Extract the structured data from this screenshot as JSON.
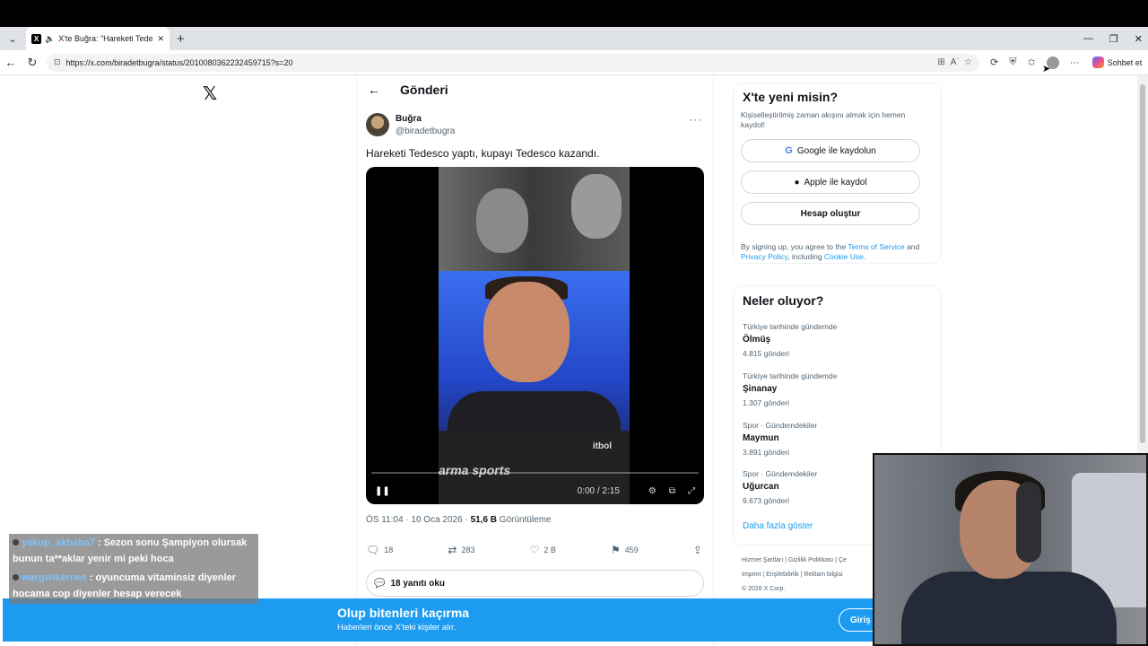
{
  "browser": {
    "tab_title": "X'te Buğra: \"Hareketi Tedesco",
    "url": "https://x.com/biradetbugra/status/2010080362232459715?s=20",
    "copilot_label": "Sohbet et"
  },
  "post": {
    "header_title": "Gönderi",
    "author_name": "Buğra",
    "author_handle": "@biradetbugra",
    "text": "Hareketi Tedesco yaptı, kupayı Tedesco kazandı.",
    "video": {
      "watermark": "arma sports",
      "logo": "itbol",
      "time": "0:00 / 2:15"
    },
    "timestamp": "ÖS 11:04 · 10 Oca 2026 · ",
    "views_count": "51,6 B",
    "views_label": " Görüntüleme",
    "stats": {
      "replies": "18",
      "reposts": "283",
      "likes": "2 B",
      "bookmarks": "459"
    },
    "read_replies": "18 yanıtı oku"
  },
  "signup": {
    "title": "X'te yeni misin?",
    "subtitle": "Kişiselleştirilmiş zaman akışını almak için hemen kaydol!",
    "google_btn": "Google ile kaydolun",
    "apple_btn": "Apple ile kaydol",
    "create_btn": "Hesap oluştur",
    "legal_pre": "By signing up, you agree to the ",
    "terms": "Terms of Service",
    "and": " and ",
    "privacy": "Privacy Policy",
    "including": ", including ",
    "cookie": "Cookie Use",
    "end": "."
  },
  "trends": {
    "title": "Neler oluyor?",
    "items": [
      {
        "context": "Türkiye tarihinde gündemde",
        "name": "Ölmüş",
        "posts": "4.815 gönderi"
      },
      {
        "context": "Türkiye tarihinde gündemde",
        "name": "Şinanay",
        "posts": "1.307 gönderi"
      },
      {
        "context": "Spor · Gündemdekiler",
        "name": "Maymun",
        "posts": "3.891 gönderi"
      },
      {
        "context": "Spor · Gündemdekiler",
        "name": "Uğurcan",
        "posts": "9.673 gönderi"
      }
    ],
    "show_more": "Daha fazla göster"
  },
  "footer": {
    "links1": "Hizmet Şartları  |  Gizlilik Politikası  |  Çe",
    "links2": "Imprint  |  Erişilebilirlik  |  Reklam bilgisi",
    "copyright": "© 2026 X Corp."
  },
  "banner": {
    "title": "Olup bitenleri kaçırma",
    "subtitle": "Haberleri önce X'teki kişiler alır.",
    "login": "Giriş"
  },
  "chat": [
    {
      "user": "yakup_akbaba7",
      "message": " : Sezon sonu Şampiyon olursak bunun ta**aklar yenir mi peki hoca"
    },
    {
      "user": "wargwikernes",
      "message": " : oyuncuma vitaminsiz diyenler hocama cop diyenler hesap verecek"
    }
  ]
}
